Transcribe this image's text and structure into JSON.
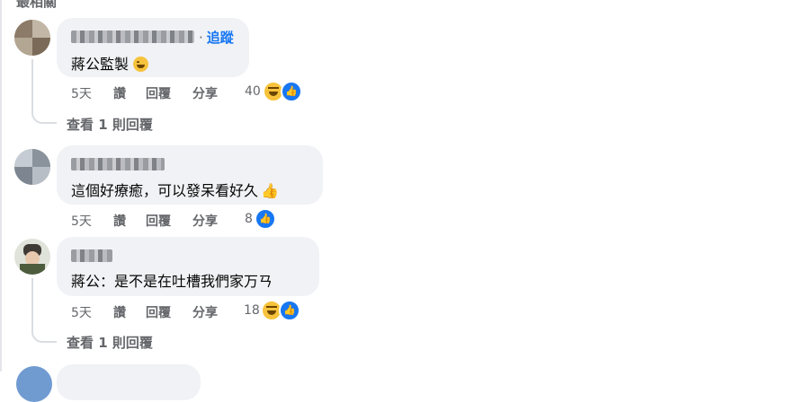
{
  "header_clip": "最相關",
  "comments": [
    {
      "follow_label": "追蹤",
      "text": "蔣公監製",
      "emoji": "laughing-face",
      "actions": [
        "5天",
        "讚",
        "回覆",
        "分享"
      ],
      "reaction_count": "40",
      "reactions": [
        "haha",
        "like"
      ],
      "view_replies": "查看 1 則回覆"
    },
    {
      "text": "這個好療癒，可以發呆看好久",
      "emoji": "thumbs-up",
      "actions": [
        "5天",
        "讚",
        "回覆",
        "分享"
      ],
      "reaction_count": "8",
      "reactions": [
        "like"
      ]
    },
    {
      "text": "蔣公：是不是在吐槽我們家万ㄢ",
      "actions": [
        "5天",
        "讚",
        "回覆",
        "分享"
      ],
      "reaction_count": "18",
      "reactions": [
        "haha",
        "like"
      ],
      "view_replies": "查看 1 則回覆"
    }
  ],
  "colors": {
    "bubble": "#f0f2f5",
    "link_blue": "#1877f2",
    "secondary_text": "#65676b"
  }
}
